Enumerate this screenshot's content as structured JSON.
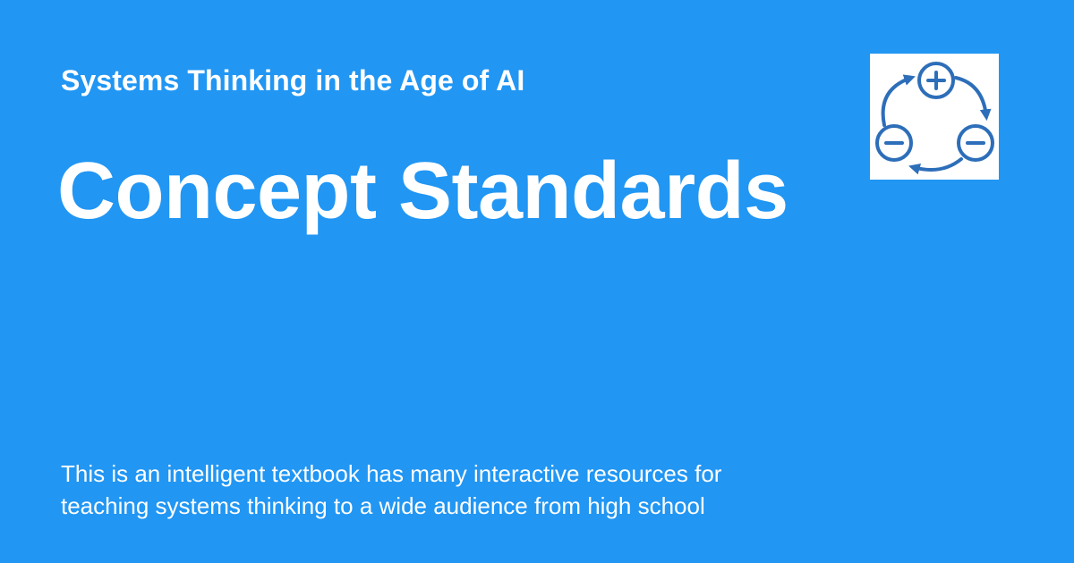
{
  "site": {
    "title": "Systems Thinking in the Age of AI"
  },
  "page": {
    "title": "Concept Standards"
  },
  "description": {
    "lines": [
      "This is an intelligent textbook has many interactive resources for",
      "teaching systems thinking to a wide audience from high school"
    ]
  },
  "logo": {
    "icon": "feedback-loop-icon",
    "color": "#2D6EB9",
    "background": "#FFFFFF"
  },
  "colors": {
    "background": "#2196F3",
    "text": "#FFFFFF"
  }
}
